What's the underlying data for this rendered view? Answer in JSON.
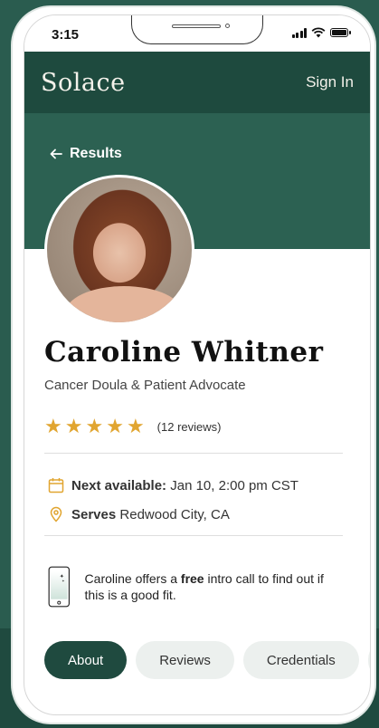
{
  "status_bar": {
    "time": "3:15"
  },
  "header": {
    "logo": "Solace",
    "sign_in": "Sign In"
  },
  "nav": {
    "back_label": "Results"
  },
  "profile": {
    "name": "Caroline Whitner",
    "title": "Cancer Doula & Patient Advocate",
    "rating_stars": 5,
    "reviews": "(12 reviews)",
    "next_available_label": "Next available:",
    "next_available_value": "Jan 10, 2:00 pm CST",
    "serves_label": "Serves",
    "serves_value": "Redwood City, CA"
  },
  "intro": {
    "text_before": "Caroline offers a ",
    "text_bold": "free",
    "text_after": " intro call to find out if this is a good fit."
  },
  "tabs": [
    {
      "label": "About",
      "active": true
    },
    {
      "label": "Reviews",
      "active": false
    },
    {
      "label": "Credentials",
      "active": false
    },
    {
      "label": "",
      "active": false
    }
  ],
  "colors": {
    "brand_dark": "#1e4a3e",
    "brand_mid": "#2c6152",
    "star": "#e1a530"
  }
}
